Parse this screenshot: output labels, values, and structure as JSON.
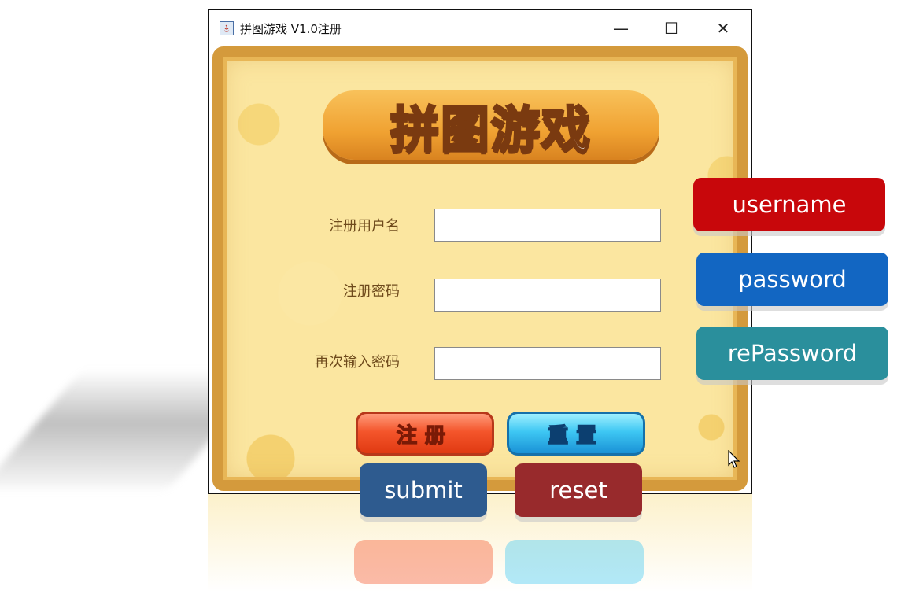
{
  "window": {
    "title": "拼图游戏 V1.0注册",
    "controls": {
      "minimize": "—",
      "maximize": "☐",
      "close": "✕"
    }
  },
  "logo": {
    "text": "拼图游戏"
  },
  "form": {
    "username_label": "注册用户名",
    "password_label": "注册密码",
    "repassword_label": "再次输入密码",
    "username_value": "",
    "password_value": "",
    "repassword_value": ""
  },
  "buttons": {
    "register_label": "注册",
    "reset_label": "重置"
  },
  "annotations": {
    "username": "username",
    "password": "password",
    "repassword": "rePassword",
    "submit": "submit",
    "reset": "reset"
  },
  "colors": {
    "username_tag": "#c8070b",
    "password_tag": "#1266c2",
    "repassword_tag": "#2a8f9c",
    "submit_tag": "#2e5b8f",
    "reset_tag": "#982a2c",
    "board_background": "#fbe6a0"
  }
}
